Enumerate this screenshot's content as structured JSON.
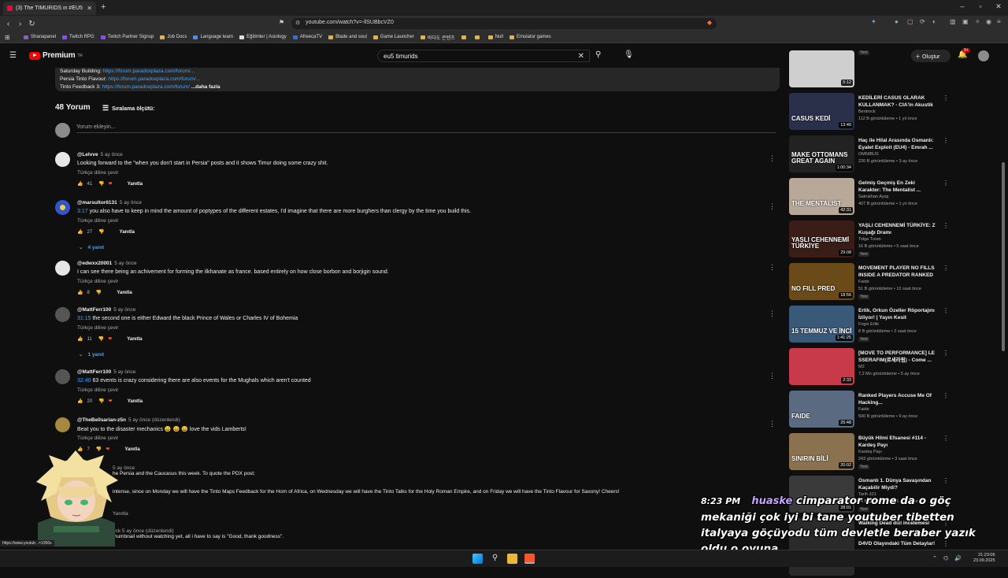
{
  "browser": {
    "tab_title": "(3) The TIMURIDS in #EU5 ha",
    "url": "youtube.com/watch?v=-llSUBbcVZ0",
    "bookmarks": [
      {
        "label": "Shanapanel",
        "color": "#8a5cd1"
      },
      {
        "label": "Twitch RPG",
        "color": "#9146ff"
      },
      {
        "label": "Twitch Partner Signup",
        "color": "#9146ff"
      },
      {
        "label": "Job Docs",
        "color": "#e2b43a"
      },
      {
        "label": "Language learn",
        "color": "#4a8cf0"
      },
      {
        "label": "Eğitimler | Asiology",
        "color": "#e0e0e0"
      },
      {
        "label": "AfreecaTV",
        "color": "#3b6bd8"
      },
      {
        "label": "Blade and soul",
        "color": "#e2b43a"
      },
      {
        "label": "Game Launcher",
        "color": "#e2b43a"
      },
      {
        "label": "바다도 콘텐츠",
        "color": "#e2b43a"
      },
      {
        "label": "",
        "color": "#e2b43a"
      },
      {
        "label": "",
        "color": "#e2b43a"
      },
      {
        "label": "Null",
        "color": "#e2b43a"
      },
      {
        "label": "Emulator games",
        "color": "#e2b43a"
      }
    ]
  },
  "youtube": {
    "logo_text": "Premium",
    "logo_sup": "TR",
    "search_value": "eu5 timurids",
    "create_label": "Oluştur",
    "notif_count": "9+"
  },
  "description": {
    "lines": [
      {
        "label": "Saturday Building:",
        "link": "https://forum.paradoxplaza.com/forum/..."
      },
      {
        "label": "Persia Tinto Flavour:",
        "link": "https://forum.paradoxplaza.com/forum/..."
      },
      {
        "label": "Tinto Feedback 3:",
        "link": "https://forum.paradoxplaza.com/forum/"
      }
    ],
    "more": "...daha fazla"
  },
  "comments_header": {
    "count": "48 Yorum",
    "sort_label": "Sıralama ölçütü:",
    "add_placeholder": "Yorum ekleyin..."
  },
  "comments": [
    {
      "author": "@Lelvve",
      "age": "5 ay önce",
      "ts": "",
      "text": "Looking forward to the \"when you don't start in Persia\" posts and it shows Timur doing some crazy shit.",
      "translate": "Türkçe diline çevir",
      "likes": "41",
      "reply": "Yanıtla",
      "replies": "",
      "avatar": "white",
      "heart": true
    },
    {
      "author": "@marsultor6131",
      "age": "5 ay önce",
      "ts": "3:17",
      "text": " you also have to keep in mind the amount of poptypes of the different estates, I'd imagine that there are more burghers than clergy by the time you build this.",
      "translate": "Türkçe diline çevir",
      "likes": "27",
      "reply": "Yanıtla",
      "replies": "4 yanıt",
      "avatar": "blue",
      "heart": false
    },
    {
      "author": "@edwxx20001",
      "age": "5 ay önce",
      "ts": "",
      "text": "I can see there being an achivement for forming the ilkhanate as france. based entirely on how close borbon and borjigin sound.",
      "translate": "Türkçe diline çevir",
      "likes": "8",
      "reply": "Yanıtla",
      "replies": "",
      "avatar": "white",
      "heart": false
    },
    {
      "author": "@MattFerr100",
      "age": "5 ay önce",
      "ts": "31:15",
      "text": " the second one is either Edward the black Prince of Wales or Charles IV of Bohemia",
      "translate": "Türkçe diline çevir",
      "likes": "11",
      "reply": "Yanıtla",
      "replies": "1 yanıt",
      "avatar": "dark",
      "heart": true
    },
    {
      "author": "@MattFerr100",
      "age": "5 ay önce",
      "ts": "32:40",
      "text": " 63 events is crazy considering there are also events for the Mughals which aren't counted",
      "translate": "Türkçe diline çevir",
      "likes": "20",
      "reply": "Yanıtla",
      "replies": "",
      "avatar": "dark",
      "heart": true
    },
    {
      "author": "@TheBellsarian-z5n",
      "age": "5 ay önce (düzenlendi)",
      "ts": "",
      "text": "Beat you to the disaster mechanics 😀 😀 😀 love the vids Lamberts!",
      "translate": "Türkçe diline çevir",
      "likes": "7",
      "reply": "Yanıtla",
      "replies": "",
      "avatar": "gold",
      "heart": true
    }
  ],
  "partial_comments": [
    {
      "meta": "5 ay önce",
      "text": "he Persia and the Caucasus this week. To quote the PDX post:"
    },
    {
      "meta": "",
      "text": "intense, since on Monday we will have the Tinto Maps Feedback for the Horn of Africa, on Wednesday we will have the Tinto Talks for the Holy Roman Empire, and on Friday we will have the Tinto Flavour for Saxony! Cheers!"
    },
    {
      "meta": "Yanıtla",
      "text": ""
    },
    {
      "meta": "eck 5 ay önce (düzenlendi)",
      "text": "thumbnail without watching yet, all i have to say is \"Good, thank goodness\"."
    }
  ],
  "sidebar": [
    {
      "thumb_text": "",
      "duration": "5:12",
      "title": "",
      "channel": "",
      "meta": "",
      "badge": "Yeni",
      "bg": "#cfcfcf"
    },
    {
      "thumb_text": "CASUS KEDİ",
      "duration": "13:40",
      "title": "KEDİLERİ CASUS OLARAK KULLANMAK? - CIA'in Akustik ...",
      "channel": "Bentrock",
      "meta": "112 B görüntüleme • 1 yıl önce",
      "badge": "",
      "bg": "#2a2f4a"
    },
    {
      "thumb_text": "MAKE OTTOMANS GREAT AGAIN",
      "duration": "1:00:34",
      "title": "Haç ile Hilal Arasında Osmanlı: Eyalet Exploit (EU4) - Emrah ...",
      "channel": "OMNIBUS",
      "meta": "230 B görüntüleme • 3 ay önce",
      "badge": "",
      "bg": "#222"
    },
    {
      "thumb_text": "THE MENTALIST",
      "duration": "42:31",
      "title": "Gelmiş Geçmiş En Zeki Karakter: The Mentalist ...",
      "channel": "Satrukhan Ayaş",
      "meta": "407 B görüntüleme • 1 yıl önce",
      "badge": "",
      "bg": "#b8a898"
    },
    {
      "thumb_text": "YAŞLI CEHENNEMİ TÜRKİYE",
      "duration": "29:08",
      "title": "YAŞLI CEHENNEMİ TÜRKİYE: Z Kuşağı Dramı",
      "channel": "Tolga Turan",
      "meta": "16 B görüntüleme • 5 saat önce",
      "badge": "Yeni",
      "bg": "#3a1d16"
    },
    {
      "thumb_text": "NO FILL PRED",
      "duration": "18:56",
      "title": "MOVEMENT PLAYER NO FILLS INSIDE A PREDATOR RANKED ...",
      "channel": "Faide",
      "meta": "51 B görüntüleme • 12 saat önce",
      "badge": "Yeni",
      "bg": "#6a4a18"
    },
    {
      "thumb_text": "15 TEMMUZ VE İNCİ",
      "duration": "1:41:25",
      "title": "Ertik, Orkun Özeller Röportajını İzliyor! | Yayın Kesit",
      "channel": "Fogix Ertik",
      "meta": "8 B görüntüleme • 2 saat önce",
      "badge": "Yeni",
      "bg": "#3a5878"
    },
    {
      "thumb_text": "",
      "duration": "2:33",
      "title": "[MOVE TO PERFORMANCE] LE SSERAFIM(르세라핌) - Come ...",
      "channel": "M2",
      "meta": "7,2 Mn görüntüleme • 5 ay önce",
      "badge": "",
      "bg": "#c83a4a"
    },
    {
      "thumb_text": "FAIDE",
      "duration": "25:48",
      "title": "Ranked Players Accuse Me Of Hacking...",
      "channel": "Faide",
      "meta": "500 B görüntüleme • 9 ay önce",
      "badge": "",
      "bg": "#5a6a80"
    },
    {
      "thumb_text": "SINIRIN BİLİ",
      "duration": "20:02",
      "title": "Büyük Hilmi Efsanesi #114 - Kardeş Payı",
      "channel": "Kardeş Payı",
      "meta": "243 görüntüleme • 3 saat önce",
      "badge": "Yeni",
      "bg": "#8a7250"
    },
    {
      "thumb_text": "",
      "duration": "28:01",
      "title": "Osmanlı 1. Dünya Savaşından Kaçabilir Miydi?",
      "channel": "Tarih 101",
      "meta": "14 B görüntüleme • 1 gün önce",
      "badge": "Yeni",
      "bg": "#3a3a3a"
    },
    {
      "thumb_text": "",
      "duration": "",
      "title": "Walking Dead dizi incelemesi",
      "channel": "",
      "meta": "",
      "badge": "",
      "bg": "#2a2a2a"
    },
    {
      "thumb_text": "",
      "duration": "",
      "title": "D4VD Olayındaki Tüm Detaylar!",
      "channel": "",
      "meta": "",
      "badge": "",
      "bg": "#2a2a2a"
    }
  ],
  "overlay": {
    "chat_time": "8:23 PM",
    "chat_user": "huaske",
    "chat_message": "cimparator rome da o göç mekaniği çok iyi bi tane youtuber tibetten italyaya göçüyodu tüm devletle beraber yazık oldu o oyuna"
  },
  "status_url": "https://www.youtub...=1950s",
  "taskbar": {
    "clock_time": "21:23:06",
    "clock_date": "23.09.2025"
  },
  "colors": {
    "accent_red": "#ff0000",
    "link_blue": "#3ea6ff",
    "bg": "#0f0f0f"
  }
}
